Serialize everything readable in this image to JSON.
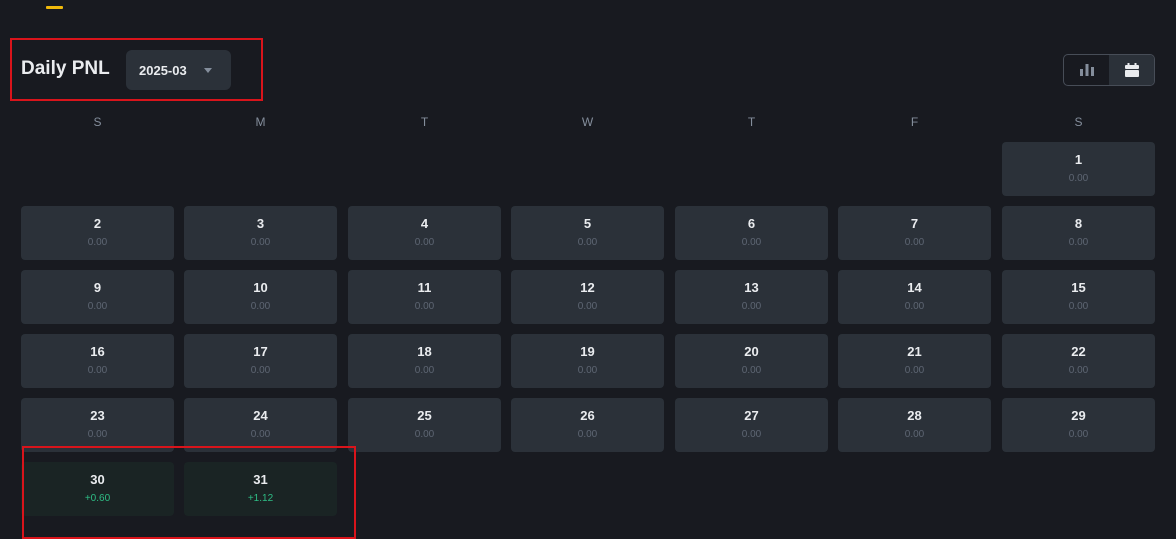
{
  "header": {
    "title": "Daily PNL",
    "selected_month": "2025-03"
  },
  "view_toggle": {
    "options": [
      "bar-chart-icon",
      "calendar-icon"
    ],
    "active": "calendar-icon"
  },
  "weekdays": [
    "S",
    "M",
    "T",
    "W",
    "T",
    "F",
    "S"
  ],
  "calendar": {
    "first_weekday_index": 6,
    "days": [
      {
        "day": "1",
        "pnl": "0.00",
        "status": "neutral"
      },
      {
        "day": "2",
        "pnl": "0.00",
        "status": "neutral"
      },
      {
        "day": "3",
        "pnl": "0.00",
        "status": "neutral"
      },
      {
        "day": "4",
        "pnl": "0.00",
        "status": "neutral"
      },
      {
        "day": "5",
        "pnl": "0.00",
        "status": "neutral"
      },
      {
        "day": "6",
        "pnl": "0.00",
        "status": "neutral"
      },
      {
        "day": "7",
        "pnl": "0.00",
        "status": "neutral"
      },
      {
        "day": "8",
        "pnl": "0.00",
        "status": "neutral"
      },
      {
        "day": "9",
        "pnl": "0.00",
        "status": "neutral"
      },
      {
        "day": "10",
        "pnl": "0.00",
        "status": "neutral"
      },
      {
        "day": "11",
        "pnl": "0.00",
        "status": "neutral"
      },
      {
        "day": "12",
        "pnl": "0.00",
        "status": "neutral"
      },
      {
        "day": "13",
        "pnl": "0.00",
        "status": "neutral"
      },
      {
        "day": "14",
        "pnl": "0.00",
        "status": "neutral"
      },
      {
        "day": "15",
        "pnl": "0.00",
        "status": "neutral"
      },
      {
        "day": "16",
        "pnl": "0.00",
        "status": "neutral"
      },
      {
        "day": "17",
        "pnl": "0.00",
        "status": "neutral"
      },
      {
        "day": "18",
        "pnl": "0.00",
        "status": "neutral"
      },
      {
        "day": "19",
        "pnl": "0.00",
        "status": "neutral"
      },
      {
        "day": "20",
        "pnl": "0.00",
        "status": "neutral"
      },
      {
        "day": "21",
        "pnl": "0.00",
        "status": "neutral"
      },
      {
        "day": "22",
        "pnl": "0.00",
        "status": "neutral"
      },
      {
        "day": "23",
        "pnl": "0.00",
        "status": "neutral"
      },
      {
        "day": "24",
        "pnl": "0.00",
        "status": "neutral"
      },
      {
        "day": "25",
        "pnl": "0.00",
        "status": "neutral"
      },
      {
        "day": "26",
        "pnl": "0.00",
        "status": "neutral"
      },
      {
        "day": "27",
        "pnl": "0.00",
        "status": "neutral"
      },
      {
        "day": "28",
        "pnl": "0.00",
        "status": "neutral"
      },
      {
        "day": "29",
        "pnl": "0.00",
        "status": "neutral"
      },
      {
        "day": "30",
        "pnl": "+0.60",
        "status": "positive"
      },
      {
        "day": "31",
        "pnl": "+1.12",
        "status": "positive"
      }
    ]
  },
  "colors": {
    "background": "#181a20",
    "cell": "#2b3139",
    "positive_cell": "#1a2424",
    "positive_text": "#2ebd85",
    "accent": "#f0b90b",
    "highlight_box": "#d9141b"
  }
}
